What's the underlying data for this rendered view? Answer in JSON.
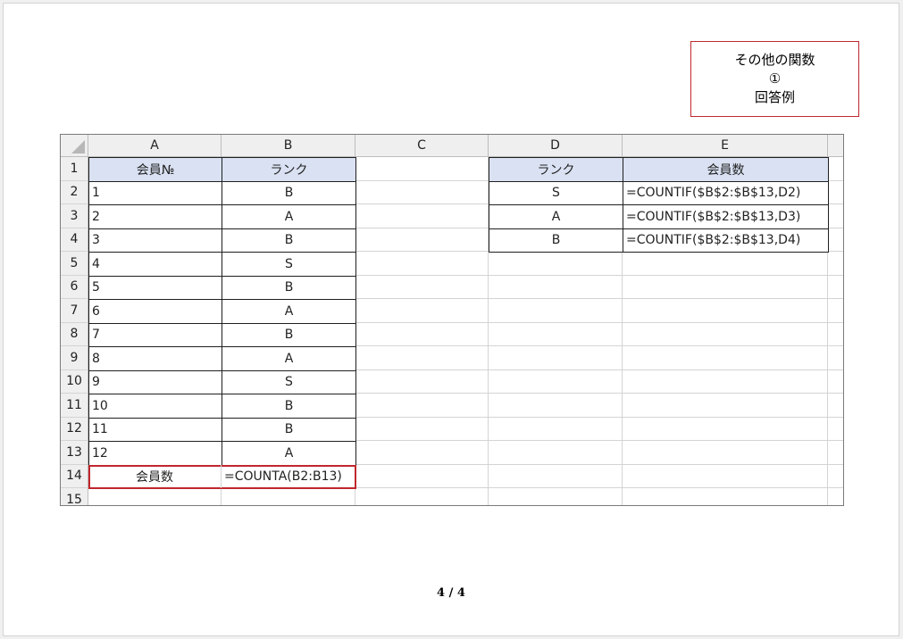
{
  "title_box": {
    "line1": "その他の関数",
    "line2": "①",
    "line3": "回答例"
  },
  "sheet": {
    "columns": [
      "A",
      "B",
      "C",
      "D",
      "E"
    ],
    "row_numbers": [
      "1",
      "2",
      "3",
      "4",
      "5",
      "6",
      "7",
      "8",
      "9",
      "10",
      "11",
      "12",
      "13",
      "14",
      "15"
    ],
    "table1": {
      "headers": [
        "会員№",
        "ランク"
      ],
      "rows": [
        [
          "1",
          "B"
        ],
        [
          "2",
          "A"
        ],
        [
          "3",
          "B"
        ],
        [
          "4",
          "S"
        ],
        [
          "5",
          "B"
        ],
        [
          "6",
          "A"
        ],
        [
          "7",
          "B"
        ],
        [
          "8",
          "A"
        ],
        [
          "9",
          "S"
        ],
        [
          "10",
          "B"
        ],
        [
          "11",
          "B"
        ],
        [
          "12",
          "A"
        ]
      ],
      "total_label": "会員数",
      "total_formula": "=COUNTA(B2:B13)"
    },
    "table2": {
      "headers": [
        "ランク",
        "会員数"
      ],
      "rows": [
        [
          "S",
          "=COUNTIF($B$2:$B$13,D2)"
        ],
        [
          "A",
          "=COUNTIF($B$2:$B$13,D3)"
        ],
        [
          "B",
          "=COUNTIF($B$2:$B$13,D4)"
        ]
      ]
    },
    "colors": {
      "header_fill": "#d9e1f2",
      "highlight_border": "#c0272d",
      "grid": "#d4d4d4"
    }
  },
  "page_number": "4 / 4"
}
